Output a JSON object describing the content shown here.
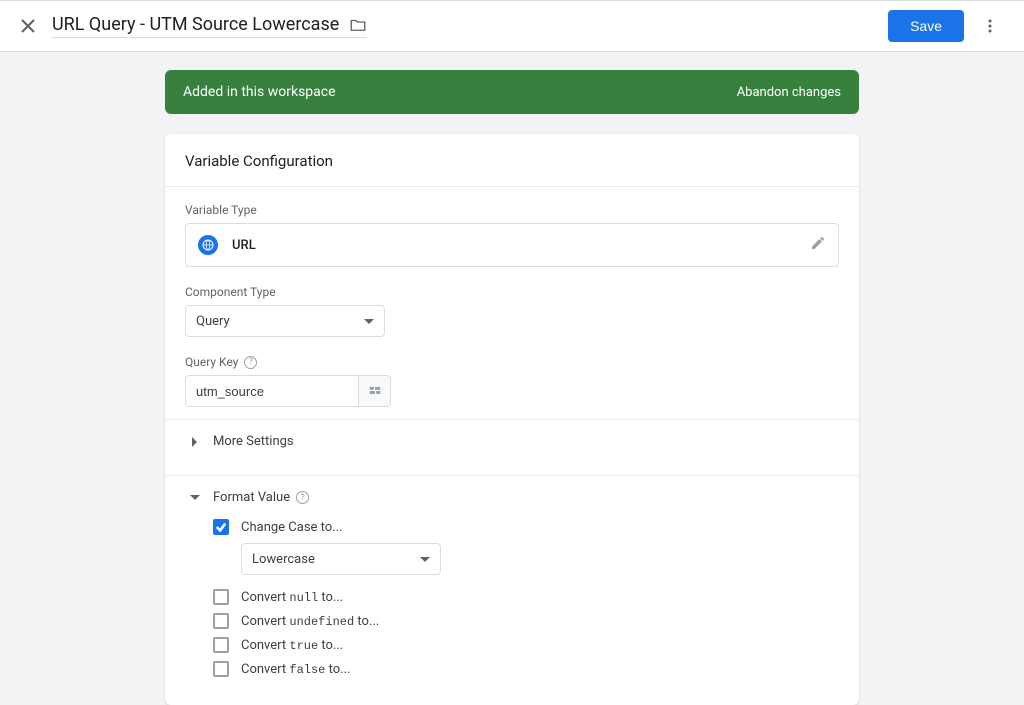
{
  "header": {
    "title": "URL Query - UTM Source Lowercase",
    "save_label": "Save"
  },
  "banner": {
    "message": "Added in this workspace",
    "abandon_label": "Abandon changes"
  },
  "card": {
    "title": "Variable Configuration",
    "variable_type_label": "Variable Type",
    "variable_type_value": "URL",
    "component_type_label": "Component Type",
    "component_type_value": "Query",
    "query_key_label": "Query Key",
    "query_key_value": "utm_source",
    "more_settings_label": "More Settings",
    "format_value_label": "Format Value",
    "change_case_label": "Change Case to...",
    "change_case_value": "Lowercase",
    "convert_null_prefix": "Convert ",
    "convert_null_mono": "null",
    "convert_null_suffix": " to...",
    "convert_undefined_prefix": "Convert ",
    "convert_undefined_mono": "undefined",
    "convert_undefined_suffix": " to...",
    "convert_true_prefix": "Convert ",
    "convert_true_mono": "true",
    "convert_true_suffix": " to...",
    "convert_false_prefix": "Convert ",
    "convert_false_mono": "false",
    "convert_false_suffix": " to..."
  }
}
